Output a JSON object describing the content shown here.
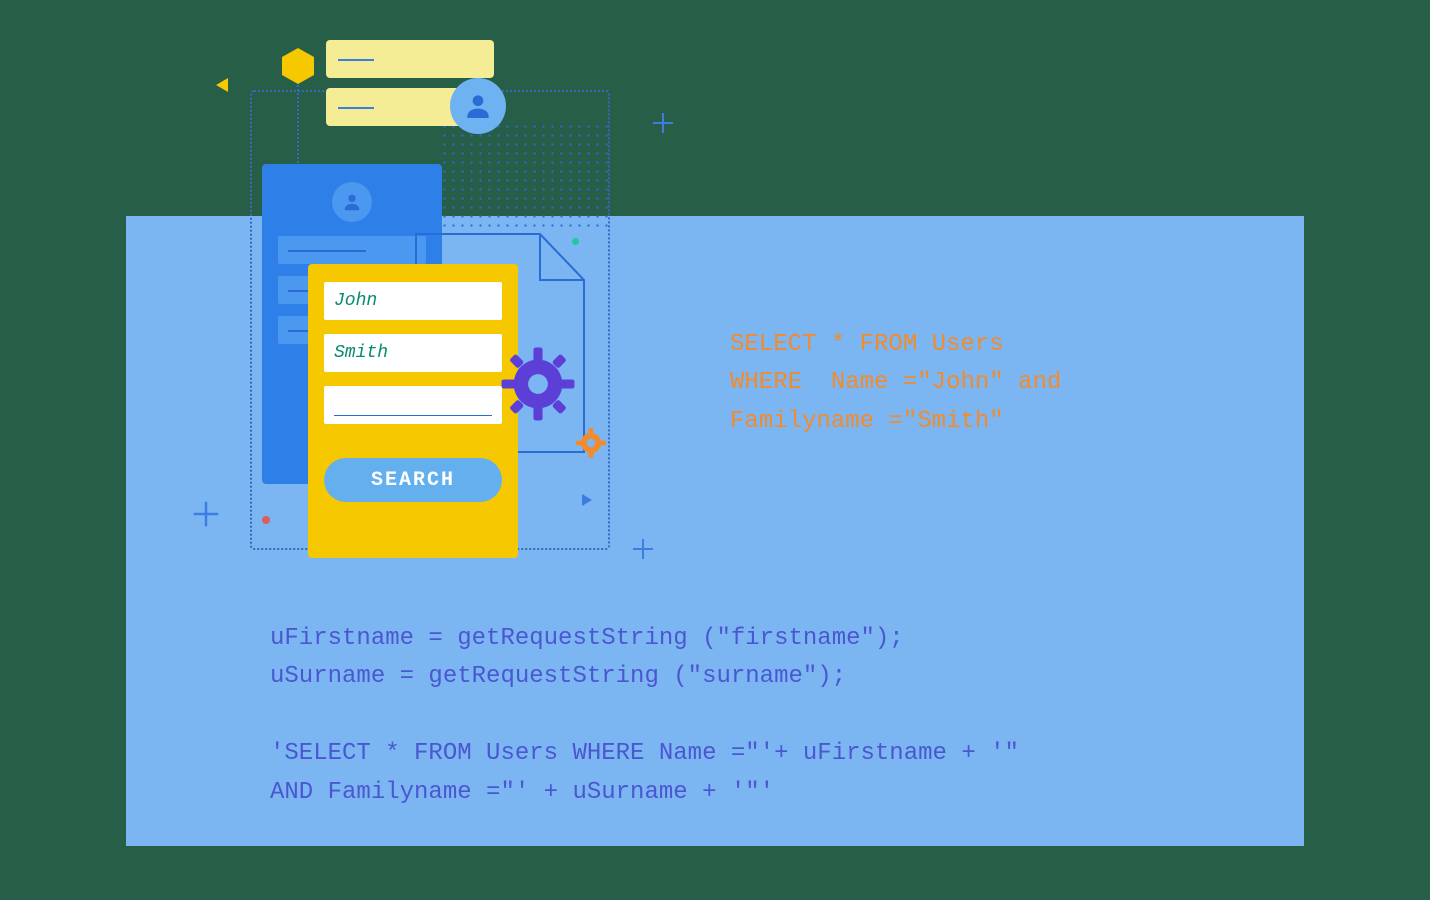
{
  "form": {
    "first_name": "John",
    "last_name": "Smith",
    "search_label": "SEARCH"
  },
  "sql": {
    "line1": "SELECT * FROM Users",
    "line2": "WHERE  Name =\"John\" and",
    "line3": "Familyname =\"Smith\""
  },
  "code": {
    "line1": "uFirstname = getRequestString (\"firstname\");",
    "line2": "uSurname = getRequestString (\"surname\");",
    "line3": "",
    "line4": "'SELECT * FROM Users WHERE Name =\"'+ uFirstname + '\"",
    "line5": "AND Familyname =\"' + uSurname + '\"'"
  }
}
